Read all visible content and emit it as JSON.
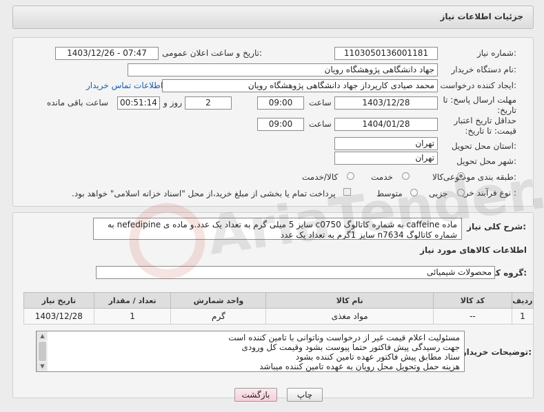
{
  "header": {
    "title": "جزئیات اطلاعات نیاز"
  },
  "form": {
    "need_number_label": "شماره نیاز:",
    "need_number": "1103050136001181",
    "announce_label": "تاریخ و ساعت اعلان عمومی:",
    "announce_value": "1403/12/26 - 07:47",
    "buyer_org_label": "نام دستگاه خریدار:",
    "buyer_org": "جهاد دانشگاهی پژوهشگاه رویان",
    "creator_label": "ایجاد کننده درخواست:",
    "creator": "محمد صیادی کارپرداز جهاد دانشگاهی پژوهشگاه رویان",
    "contact_link": "اطلاعات تماس خریدار",
    "deadline_label": "مهلت ارسال پاسخ: تا تاریخ:",
    "deadline_date": "1403/12/28",
    "time_label": "ساعت",
    "deadline_time": "09:00",
    "days_value": "2",
    "days_label": "روز و",
    "remaining_time": "00:51:14",
    "remaining_label": "ساعت باقی مانده",
    "validity_label": "حداقل تاریخ اعتبار قیمت: تا تاریخ:",
    "validity_date": "1404/01/28",
    "validity_time": "09:00",
    "province_label": "استان محل تحویل:",
    "province": "تهران",
    "city_label": "شهر محل تحویل:",
    "city": "تهران",
    "category_label": "طبقه بندی موضوعی:",
    "category_options": [
      "کالا",
      "خدمت",
      "کالا/خدمت"
    ],
    "purchase_type_label": "نوع فرآیند خرید :",
    "purchase_options": [
      "جزیی",
      "متوسط"
    ],
    "payment_note": "پرداخت تمام یا بخشی از مبلغ خرید،از محل \"اسناد خزانه اسلامی\" خواهد بود."
  },
  "description": {
    "label": "شرح کلی نیاز:",
    "text": "ماده caffeine به شماره کاتالوگ c0750 سایز 5 میلی گرم به تعداد یک عدد.و ماده ی nefedipine به شماره کاتالوگ n7634 سایز 1گرم به تعداد یک عدد"
  },
  "goods": {
    "section_title": "اطلاعات کالاهای مورد نیاز",
    "group_label": "گروه کالا:",
    "group_value": "محصولات شیمیائی",
    "columns": [
      "ردیف",
      "کد کالا",
      "نام کالا",
      "واحد شمارش",
      "تعداد / مقدار",
      "تاریخ نیاز"
    ],
    "rows": [
      [
        "1",
        "--",
        "مواد مغذی",
        "گرم",
        "1",
        "1403/12/28"
      ]
    ]
  },
  "buyer_notes": {
    "label": "توضیحات خریدار:",
    "lines": [
      "مسئولیت اعلام قیمت  غیر از درخواست وناتوانی با تامین کننده است",
      "جهت رسیدگی پیش فاکتور حتما پیوست بشود وقیمت کل ورودی",
      "ستاد مطابق پیش فاکتور عهده تامین کننده بشود",
      "هزینه حمل وتحویل محل رویان به عهده تامین کننده میباشد"
    ]
  },
  "buttons": {
    "print": "چاپ",
    "back": "بازگشت"
  },
  "watermark_text": "AriaTender.neT"
}
